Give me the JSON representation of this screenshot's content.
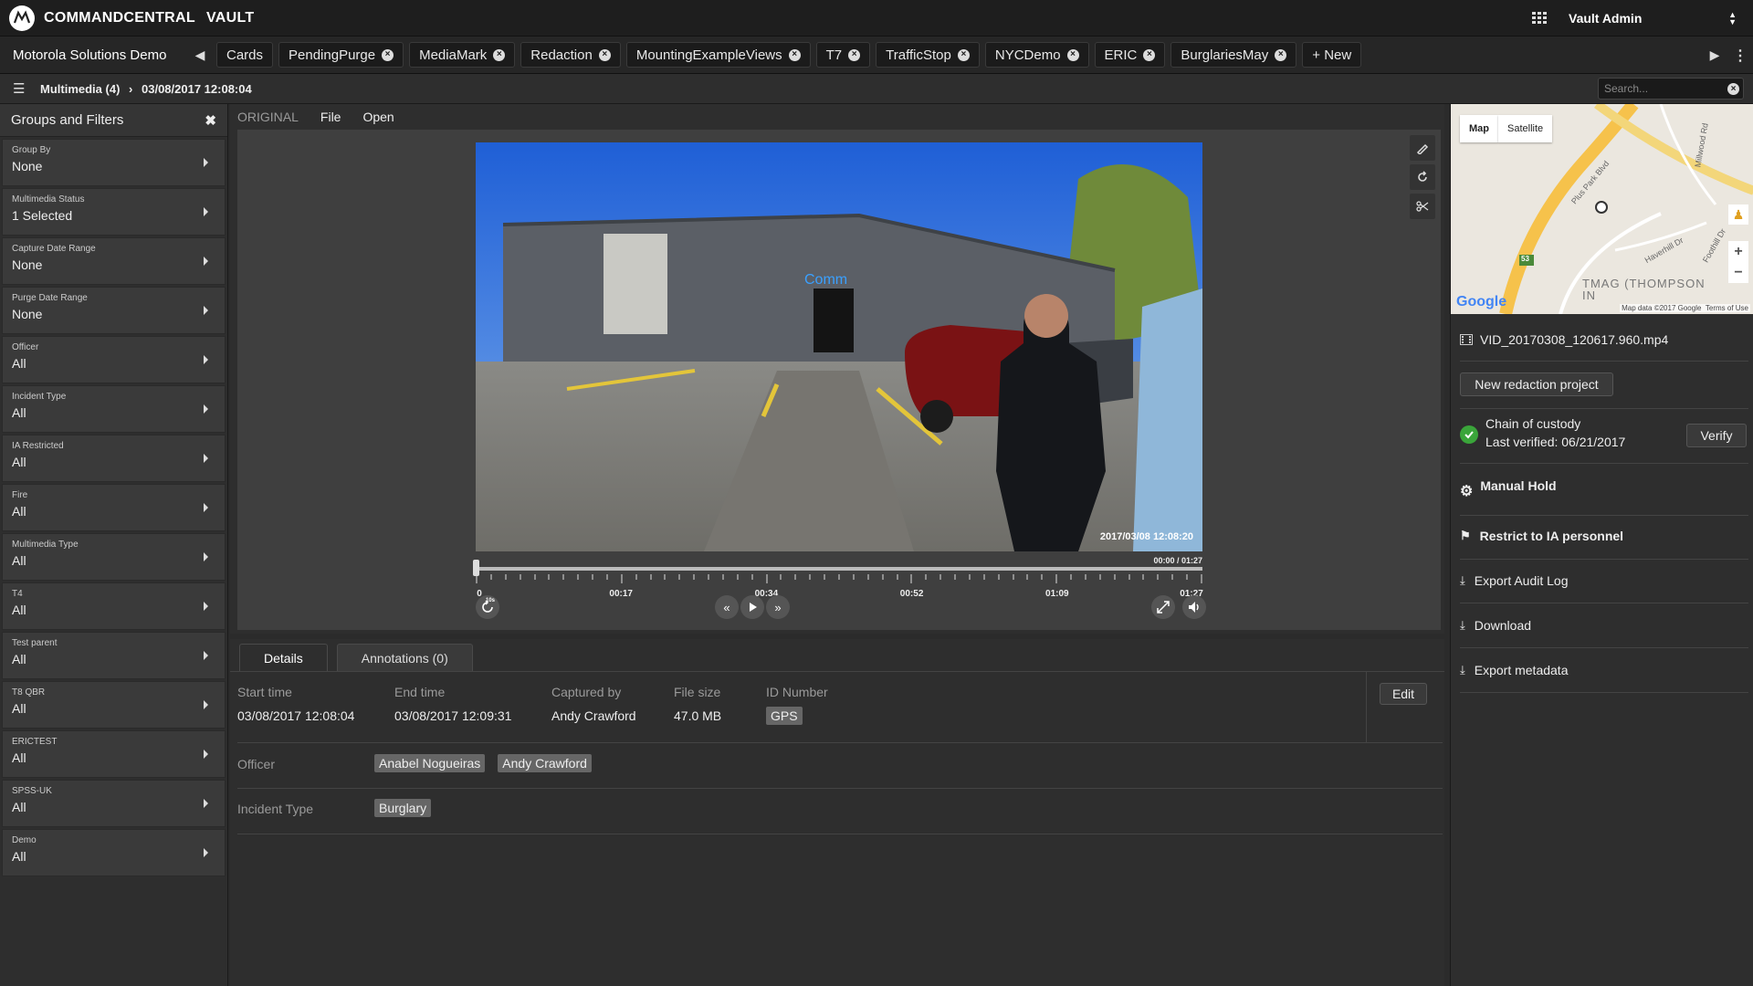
{
  "app": {
    "brand": "COMMANDCENTRAL",
    "product": "VAULT",
    "user": "Vault Admin"
  },
  "tabbar": {
    "org": "Motorola Solutions Demo",
    "tabs": [
      {
        "label": "Cards",
        "closable": false
      },
      {
        "label": "PendingPurge",
        "closable": true
      },
      {
        "label": "MediaMark",
        "closable": true
      },
      {
        "label": "Redaction",
        "closable": true
      },
      {
        "label": "MountingExampleViews",
        "closable": true
      },
      {
        "label": "T7",
        "closable": true
      },
      {
        "label": "TrafficStop",
        "closable": true
      },
      {
        "label": "NYCDemo",
        "closable": true
      },
      {
        "label": "ERIC",
        "closable": true
      },
      {
        "label": "BurglariesMay",
        "closable": true
      },
      {
        "label": "+ New",
        "closable": false
      }
    ]
  },
  "breadcrumb": {
    "parent": "Multimedia (4)",
    "current": "03/08/2017 12:08:04"
  },
  "search": {
    "placeholder": "Search..."
  },
  "sidebar": {
    "title": "Groups and Filters",
    "filters": [
      {
        "label": "Group By",
        "value": "None"
      },
      {
        "label": "Multimedia Status",
        "value": "1 Selected"
      },
      {
        "label": "Capture Date Range",
        "value": "None"
      },
      {
        "label": "Purge Date Range",
        "value": "None"
      },
      {
        "label": "Officer",
        "value": "All"
      },
      {
        "label": "Incident Type",
        "value": "All"
      },
      {
        "label": "IA Restricted",
        "value": "All"
      },
      {
        "label": "Fire",
        "value": "All"
      },
      {
        "label": "Multimedia Type",
        "value": "All"
      },
      {
        "label": "T4",
        "value": "All"
      },
      {
        "label": "Test parent",
        "value": "All"
      },
      {
        "label": "T8 QBR",
        "value": "All"
      },
      {
        "label": "ERICTEST",
        "value": "All"
      },
      {
        "label": "SPSS-UK",
        "value": "All"
      },
      {
        "label": "Demo",
        "value": "All"
      }
    ]
  },
  "player": {
    "menu": {
      "original": "ORIGINAL",
      "file": "File",
      "open": "Open"
    },
    "timestamp": "2017/03/08 12:08:20",
    "time_display": "00:00 / 01:27",
    "tick_labels": [
      "0",
      "00:17",
      "00:34",
      "00:52",
      "01:09",
      "01:27"
    ],
    "progress": 0.0,
    "skip_back_label": "10s"
  },
  "details": {
    "tabs": [
      "Details",
      "Annotations (0)"
    ],
    "fields": [
      {
        "label": "Start time",
        "value": "03/08/2017 12:08:04"
      },
      {
        "label": "End time",
        "value": "03/08/2017 12:09:31"
      },
      {
        "label": "Captured by",
        "value": "Andy Crawford"
      },
      {
        "label": "File size",
        "value": "47.0 MB"
      },
      {
        "label": "ID Number",
        "value": "GPS"
      }
    ],
    "edit_label": "Edit",
    "officer_label": "Officer",
    "officers": [
      "Anabel Nogueiras",
      "Andy Crawford"
    ],
    "incident_label": "Incident Type",
    "incident_types": [
      "Burglary"
    ]
  },
  "right": {
    "map": {
      "map_label": "Map",
      "satellite_label": "Satellite",
      "google": "Google",
      "attribution": "Map data ©2017 Google",
      "terms": "Terms of Use",
      "place": "TMAG (THOMPSON IN",
      "street1": "Plus Park Blvd",
      "street2": "Haverhill Dr",
      "street3": "Millwood Rd",
      "street4": "Foothill Dr",
      "route": "53"
    },
    "filename": "VID_20170308_120617.960.mp4",
    "new_redaction": "New redaction project",
    "custody_title": "Chain of custody",
    "custody_verified": "Last verified: 06/21/2017",
    "verify": "Verify",
    "manual_hold": "Manual Hold",
    "restrict": "Restrict to IA personnel",
    "export_audit": "Export Audit Log",
    "download": "Download",
    "export_metadata": "Export metadata"
  },
  "colors": {
    "accent_green": "#3aa53a",
    "bg_dark": "#2e2e2e"
  }
}
